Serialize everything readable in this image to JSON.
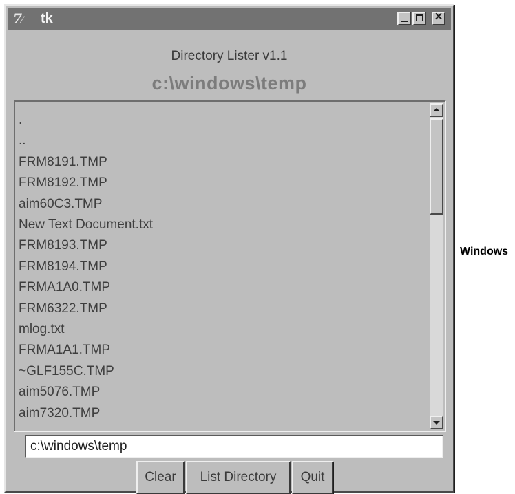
{
  "window": {
    "title": "tk",
    "app_icon": "tk-feather-icon"
  },
  "titlebar_buttons": {
    "minimize_icon": "minimize-icon",
    "maximize_icon": "maximize-icon",
    "close_icon": "close-icon",
    "close_glyph": "✕"
  },
  "heading": "Directory Lister v1.1",
  "current_path": "c:\\windows\\temp",
  "files": [
    ".",
    "..",
    "FRM8191.TMP",
    "FRM8192.TMP",
    "aim60C3.TMP",
    "New Text Document.txt",
    "FRM8193.TMP",
    "FRM8194.TMP",
    "FRMA1A0.TMP",
    "FRM6322.TMP",
    "mlog.txt",
    "FRMA1A1.TMP",
    "~GLF155C.TMP",
    "aim5076.TMP",
    "aim7320.TMP"
  ],
  "entry": {
    "value": "c:\\windows\\temp"
  },
  "buttons": {
    "clear": "Clear",
    "list_directory": "List Directory",
    "quit": "Quit"
  },
  "side_caption": "Windows",
  "colors": {
    "window_bg": "#bdbdbd",
    "titlebar_bg": "#727272",
    "path_heading": "#7c7c7c"
  }
}
